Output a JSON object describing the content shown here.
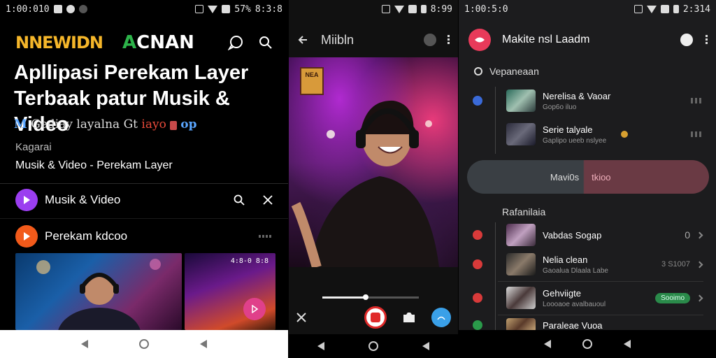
{
  "panel1": {
    "status": {
      "time": "1:00:010",
      "battery": "57%",
      "clock": "8:3:8"
    },
    "brand": {
      "logo1": "NNEWIDN",
      "logo2_mark": "A",
      "logo2_text": "CNAN"
    },
    "title": "Apllipasi Perekam Layer Terbaak patur Musik & Video",
    "subtitle": {
      "prefix": "M",
      "main": "Gediay layalna Gt",
      "mid": "iayo",
      "suffix": "op"
    },
    "category_label": "Kagarai",
    "category_value": "Musik & Video - Perekam Layer",
    "row_music": {
      "label": "Musik & Video",
      "color": "#9b3ef0"
    },
    "row_recorder": {
      "label": "Perekam kdcoo",
      "color": "#f25a1a"
    },
    "thumb_timecode": "4:8-0 8:8",
    "accent": "#e0408a"
  },
  "panel2": {
    "status": {
      "time": "",
      "clock": "8:99"
    },
    "title": "Miibln",
    "sticker_text": "NEA",
    "playback_progress": 0.45,
    "rec_color": "#e02a2a",
    "accent_blue": "#3aa0e8"
  },
  "panel3": {
    "status": {
      "time": "1:00:5:0",
      "clock": "2:314"
    },
    "title": "Makite nsl Laadm",
    "section1": "Vepaneaan",
    "items_top": [
      {
        "name": "Nerelisa & Vaoar",
        "sub": "Gop6o iluo",
        "dot": "#3a6ad8",
        "thumb": "linear-gradient(135deg,#2a6a5a,#a0c0b0,#2a3a3a)",
        "right": ""
      },
      {
        "name": "Serie talyale",
        "sub": "Gaplipo ueeb nslyee",
        "dot": "",
        "thumb": "linear-gradient(135deg,#2a2a3a,#6a6a7a,#1a1a2a)",
        "right": ""
      }
    ],
    "pill": {
      "left": "Mavi0s",
      "right": "tkioo"
    },
    "section2": "Rafanilaia",
    "items_bottom": [
      {
        "name": "Vabdas Sogap",
        "sub": "",
        "dot": "#d83a3a",
        "thumb": "linear-gradient(135deg,#4a2a4a,#c0a0c0,#3a2a3a)",
        "right": "0"
      },
      {
        "name": "Nelia clean",
        "sub": "Gaoalua Dlaala Labe",
        "dot": "#d83a3a",
        "thumb": "linear-gradient(135deg,#2a2a2a,#8a7a6a,#1a1a1a)",
        "right": "3 S1007"
      },
      {
        "name": "Gehviigte",
        "sub": "Loooaoe avalbauoul",
        "dot": "#d83a3a",
        "thumb": "linear-gradient(135deg,#dcdcdc,#4a3a3a,#cfcfcf)",
        "right": "Sooimo"
      },
      {
        "name": "Paraleae Vuoa",
        "sub": "",
        "dot": "#2a9a4a",
        "thumb": "linear-gradient(135deg,#c0a070,#5a3a2a,#d0b080)",
        "right": ""
      }
    ]
  }
}
